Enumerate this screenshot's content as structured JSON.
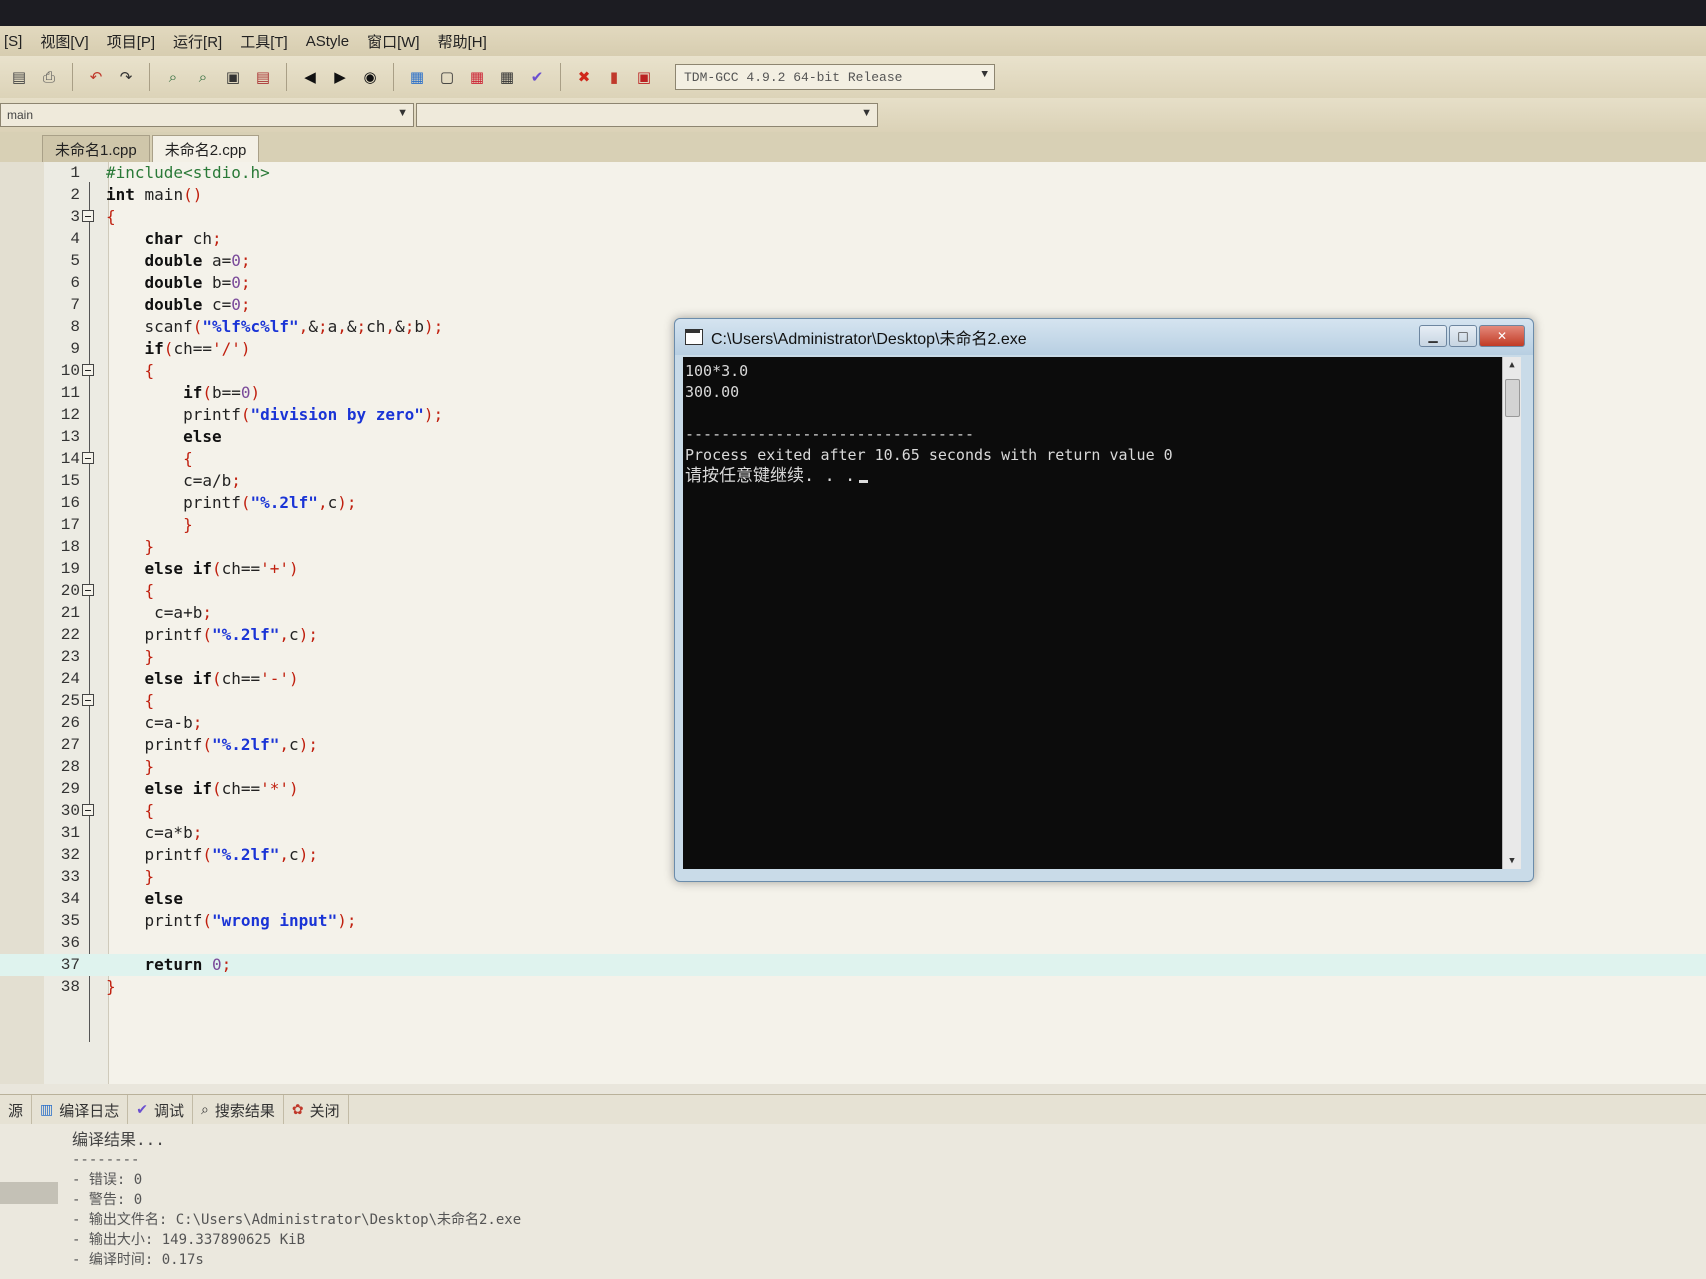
{
  "menu": [
    "[S]",
    "视图[V]",
    "项目[P]",
    "运行[R]",
    "工具[T]",
    "AStyle",
    "窗口[W]",
    "帮助[H]"
  ],
  "toolbar": {
    "compiler": "TDM-GCC 4.9.2 64-bit Release"
  },
  "scope": {
    "left_value": "main",
    "right_value": ""
  },
  "tabs": [
    "未命名1.cpp",
    "未命名2.cpp"
  ],
  "code_lines": [
    "#include<stdio.h>",
    "int main()",
    "{",
    "    char ch;",
    "    double a=0;",
    "    double b=0;",
    "    double c=0;",
    "    scanf(\"%lf%c%lf\",&a,&ch,&b);",
    "    if(ch=='/')",
    "    {",
    "        if(b==0)",
    "        printf(\"division by zero\");",
    "        else",
    "        {",
    "        c=a/b;",
    "        printf(\"%.2lf\",c);",
    "        }",
    "    }",
    "    else if(ch=='+')",
    "    {",
    "     c=a+b;",
    "    printf(\"%.2lf\",c);",
    "    }",
    "    else if(ch=='-')",
    "    {",
    "    c=a-b;",
    "    printf(\"%.2lf\",c);",
    "    }",
    "    else if(ch=='*')",
    "    {",
    "    c=a*b;",
    "    printf(\"%.2lf\",c);",
    "    }",
    "    else",
    "    printf(\"wrong input\");",
    "",
    "    return 0;",
    "}"
  ],
  "console": {
    "title": "C:\\Users\\Administrator\\Desktop\\未命名2.exe",
    "lines": [
      "100*3.0",
      "300.00",
      "",
      "--------------------------------",
      "Process exited after 10.65 seconds with return value 0",
      "请按任意键继续. . ."
    ]
  },
  "bottom_tabs": [
    "源",
    "编译日志",
    "调试",
    "搜索结果",
    "关闭"
  ],
  "log": [
    "编译结果...",
    "--------",
    "- 错误: 0",
    "- 警告: 0",
    "- 输出文件名: C:\\Users\\Administrator\\Desktop\\未命名2.exe",
    "- 输出大小: 149.337890625 KiB",
    "- 编译时间: 0.17s"
  ]
}
